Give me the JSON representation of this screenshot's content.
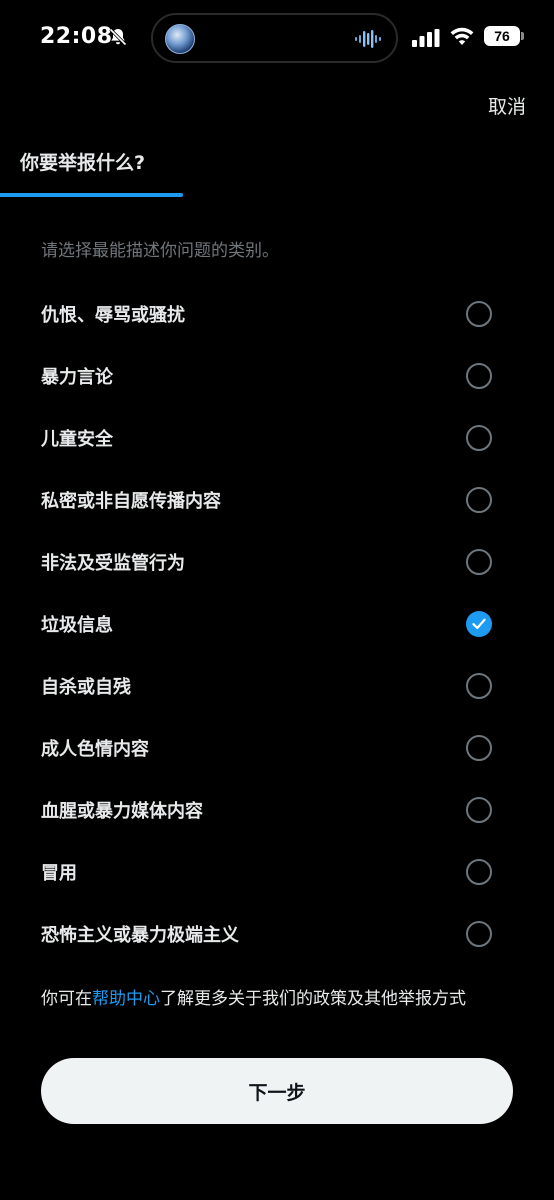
{
  "status_bar": {
    "time": "22:08",
    "battery": "76"
  },
  "header": {
    "cancel_label": "取消",
    "title": "你要举报什么?",
    "subtitle": "请选择最能描述你问题的类别。"
  },
  "options": [
    {
      "label": "仇恨、辱骂或骚扰",
      "selected": false
    },
    {
      "label": "暴力言论",
      "selected": false
    },
    {
      "label": "儿童安全",
      "selected": false
    },
    {
      "label": "私密或非自愿传播内容",
      "selected": false
    },
    {
      "label": "非法及受监管行为",
      "selected": false
    },
    {
      "label": "垃圾信息",
      "selected": true
    },
    {
      "label": "自杀或自残",
      "selected": false
    },
    {
      "label": "成人色情内容",
      "selected": false
    },
    {
      "label": "血腥或暴力媒体内容",
      "selected": false
    },
    {
      "label": "冒用",
      "selected": false
    },
    {
      "label": "恐怖主义或暴力极端主义",
      "selected": false
    }
  ],
  "footer": {
    "note_prefix": "你可在",
    "note_link": "帮助中心",
    "note_suffix": "了解更多关于我们的政策及其他举报方式"
  },
  "next_button_label": "下一步",
  "colors": {
    "background": "#000000",
    "accent": "#1d9bf0",
    "text_primary": "#e7e9ea",
    "text_secondary": "#71767b",
    "button_bg": "#eff3f4"
  }
}
